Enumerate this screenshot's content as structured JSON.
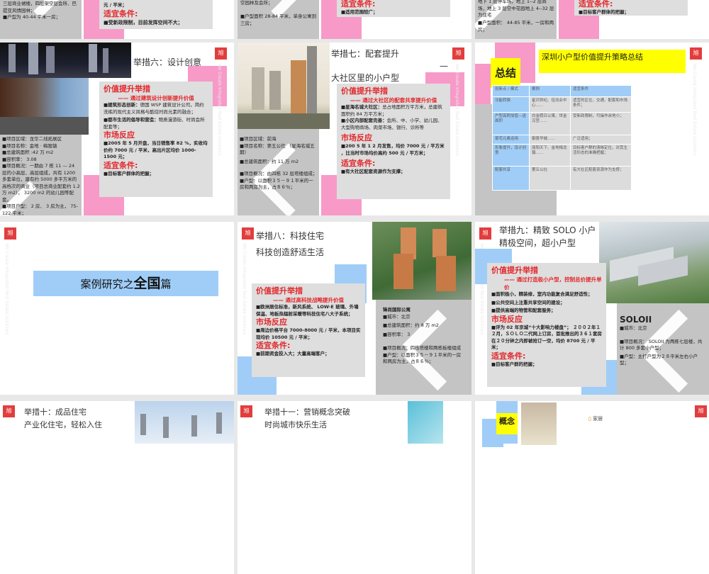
{
  "common": {
    "watermark": "We Create Integrated Real Estate Solutions",
    "logo": "旭"
  },
  "r1": {
    "s1": {
      "left": [
        "三层商业裙楼，四层架空层会所、巴提亚风情园林；",
        "■户型为 40-44 平米一房；"
      ],
      "box_top": "元 / 平米；",
      "cond_h": "适宜条件:",
      "cond": "■受新政限制，目前发挥空间不大；"
    },
    "s2": {
      "left": [
        "空园林及会所；",
        "■户型面积 28-84 平米，单身公寓到三房；"
      ],
      "cond_h": "适宜条件:",
      "cond": "■适用范围较广；"
    },
    "s3": {
      "left": [
        "地下 1 层停车场，地上 1--2 层商场，地上 3 层空中花园地上 4--32 层为住宅",
        "■户型面积： 44-85 平米，一房和两房；"
      ],
      "cond_h": "适宜条件:",
      "cond": "■目标客户群体的把握；"
    }
  },
  "r2": {
    "s1": {
      "title": "举措六：设计创意",
      "h1": "价值提升举措",
      "sub": "—— 通过建筑设计创新提升价值",
      "b1_label": "■建筑形态创新：",
      "b1": "德国 WSP 建筑设计公司，简约洗练的现代主义风格与酷炫时尚元素的融合；",
      "b2_label": "■都市生活的倡导和营造：",
      "b2": "物质漫游街、时尚会所配套等；",
      "h2": "市场反应",
      "market": "■2005 年 5 月开盘，当日销售率 82 %，实收均价约 7000 元 / 平米，高出片区均价 1000-1500 元；",
      "h3": "适宜条件:",
      "cond": "■目标客户群体的把握；",
      "info": [
        "■项目区域：龙华二线拓展区",
        "■项目名称：金地 · 梅陇镇",
        "■总建筑面积 :42 万 m2",
        "■容积率： 3.08",
        "■项目概况：一期由 7 栋 11 — 24 层的小高层、高层组成，共有 1200 多套单位，建有约 5000 多平方米的高档次的商业（项目总商业配套约 1.2 万 m2）， 3200 m2 的幼儿园等配套。",
        "■项目户型： 2 房、 3 房为主， 75-122 平米；"
      ]
    },
    "s2": {
      "title1": "举措七：配套提升",
      "dash": "—",
      "title2": "大社区里的小户型",
      "h1": "价值提升举措",
      "sub": "—— 通过大社区的配套共享提升价值",
      "b1_label": "■星海名城大社区：",
      "b1": "总占地面积万平方米，总建筑面积约 84 万平方米；",
      "b2_label": "■小区内部配套完善：",
      "b2": "会所、中、小学、幼儿园、大型购物商场、肉菜市场、银行、诊所等",
      "h2": "市场反应",
      "market": "■200 5 年 1 2 月发售，均价 7000 元 / 平方米 ，比当时市场均价高约 500 元 / 平方米；",
      "h3": "适宜条件:",
      "cond": "■有大社区配套资源作为支撑；",
      "info": [
        "■项目区域：前海",
        "■项目名称：第五公社 （星海名城五期）",
        "■总建筑面积：约 11 万 m2",
        "■项目概况：由四栋 32 层塔楼组成；",
        "■户型：以面积３５－９１平米的一房和两房为主，占８６％；"
      ]
    },
    "s3": {
      "label": "总结",
      "title": "深圳小户型价值提升策略总结",
      "table": {
        "headers": [
          "创新点 / 模式",
          "案例",
          "适宜条件"
        ],
        "rows": [
          [
            "功能转换",
            "星河世纪、佳兆业中心……",
            "适宜的区位、交通、配套和市场条件；"
          ],
          [
            "户型高附加值—送面积",
            "白金假日公寓、世金汉宫……",
            "受新政限制，可操作余地小；"
          ],
          [
            "豪宅元素运用",
            "御景华城……",
            "广泛适用；"
          ],
          [
            "形象提升，设计创意",
            "丽阳天下、金地梅龙镇……",
            "目标客户群的清晰定位，对其生活形态的准确把握；"
          ],
          [
            "配套共享",
            "第五公社",
            "有大社区配套资源作为支撑；"
          ]
        ]
      }
    }
  },
  "r3": {
    "s1": {
      "title_a": "案例研究之",
      "title_b": "全国",
      "title_c": "篇"
    },
    "s2": {
      "title1": "举措八：科技住宅",
      "title2": "科技创造舒适生活",
      "h1": "价值提升举措",
      "sub": "—— 通过高科技战略提升价值",
      "b1": "■欧洲居住标准，新风系统、 LOW-E 玻璃、外墙保温、地板热辐射采暖等科技住宅八大子系统；",
      "h2": "市场反应",
      "market": "■周边价格平台 7000-8000 元 / 平米，本项目实现均价 10500 元 / 平米；",
      "h3": "适宜条件:",
      "cond": "■前期资金投入大；大量高端客户；",
      "info_title": "锋尚国际公寓",
      "info": [
        "■城市：北京",
        "■总建筑面积：约 8 万 m2",
        "■容积率： 3",
        "■项目概况：四栋塔楼和两栋板楼组成",
        "■户型：以面积３５－９１平米的一房和两房为主，占８６％；"
      ]
    },
    "s3": {
      "title1": "举措九：精致 SOLO 小户",
      "title2": "精极空间，超小户型",
      "h1": "价值提升举措",
      "sub": "—— 通过打造极小户型，控制总价提升单价",
      "b1": "■面积极小，精装修，室内功能复合满足舒适性；",
      "b2": "■公共空间上注重共享空间的建设；",
      "b3": "■提供高端的物管和配套服务；",
      "h2": "市场反应",
      "market": "■评为 02 年京城“十大影响力楼盘”； ２００２年１２月，ＳＯＬＯ二代网上订房，首批推出的３６１套房在２０分钟之内即被抢订一空，均价 8700 元 / 平米；",
      "h3": "适宜条件:",
      "cond": "■目标客户群的把握；",
      "info_title": "SOLOII",
      "info": [
        "■城市：北京",
        "■项目概况： SOLOII 为两栋七层楼，共计 800 多套小户型；",
        "■户型：主打户型为２８平米左右小户型；"
      ]
    }
  },
  "r4": {
    "s1": {
      "title1": "举措十：成品住宅",
      "title2": "产业化住宅，轻松入住"
    },
    "s2": {
      "title1": "举措十一：营销概念突破",
      "title2": "时尚城市快乐生活"
    },
    "s3": {
      "label": "概念",
      "item": "家居"
    }
  }
}
